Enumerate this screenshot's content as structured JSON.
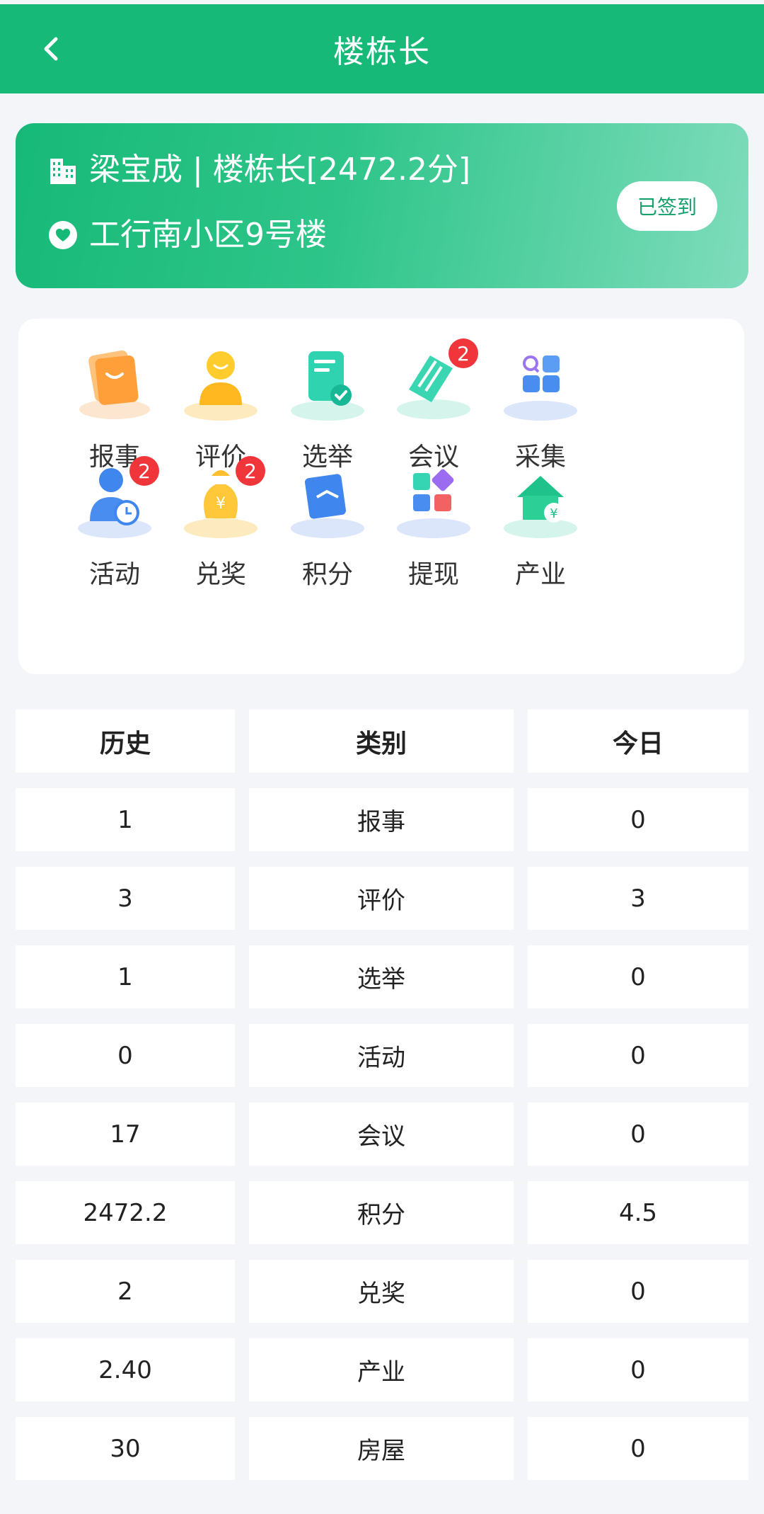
{
  "header": {
    "title": "楼栋长"
  },
  "profile": {
    "name_line": "梁宝成 | 楼栋长[2472.2分]",
    "address": "工行南小区9号楼",
    "signin_label": "已签到"
  },
  "menu": [
    {
      "label": "报事",
      "icon": "report-icon",
      "badge": ""
    },
    {
      "label": "评价",
      "icon": "evaluate-icon",
      "badge": ""
    },
    {
      "label": "选举",
      "icon": "election-icon",
      "badge": ""
    },
    {
      "label": "会议",
      "icon": "meeting-icon",
      "badge": "2"
    },
    {
      "label": "采集",
      "icon": "collect-icon",
      "badge": ""
    },
    {
      "label": "活动",
      "icon": "activity-icon",
      "badge": "2"
    },
    {
      "label": "兑奖",
      "icon": "redeem-icon",
      "badge": "2"
    },
    {
      "label": "积分",
      "icon": "points-icon",
      "badge": ""
    },
    {
      "label": "提现",
      "icon": "withdraw-icon",
      "badge": ""
    },
    {
      "label": "产业",
      "icon": "industry-icon",
      "badge": ""
    }
  ],
  "stats": {
    "headers": [
      "历史",
      "类别",
      "今日"
    ],
    "rows": [
      [
        "1",
        "报事",
        "0"
      ],
      [
        "3",
        "评价",
        "3"
      ],
      [
        "1",
        "选举",
        "0"
      ],
      [
        "0",
        "活动",
        "0"
      ],
      [
        "17",
        "会议",
        "0"
      ],
      [
        "2472.2",
        "积分",
        "4.5"
      ],
      [
        "2",
        "兑奖",
        "0"
      ],
      [
        "2.40",
        "产业",
        "0"
      ],
      [
        "30",
        "房屋",
        "0"
      ]
    ]
  },
  "colors": {
    "primary": "#17b978",
    "badge": "#f0353b",
    "background": "#f4f5f9"
  }
}
